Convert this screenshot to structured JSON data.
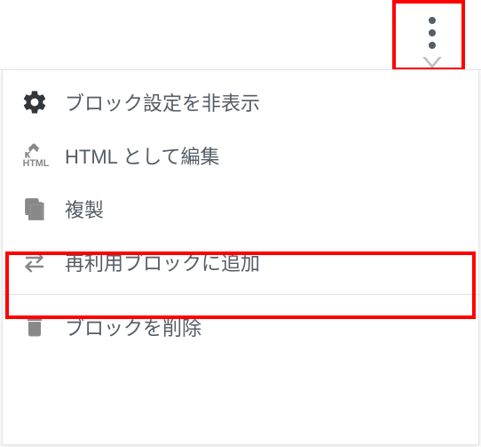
{
  "menu": {
    "hideSettings": "ブロック設定を非表示",
    "editAsHtml": "HTML として編集",
    "duplicate": "複製",
    "addToReusable": "再利用ブロックに追加",
    "deleteBlock": "ブロックを削除"
  },
  "icons": {
    "more": "more-vertical",
    "gear": "gear",
    "html": "html",
    "copy": "copy",
    "reuse": "refresh",
    "trash": "trash"
  }
}
